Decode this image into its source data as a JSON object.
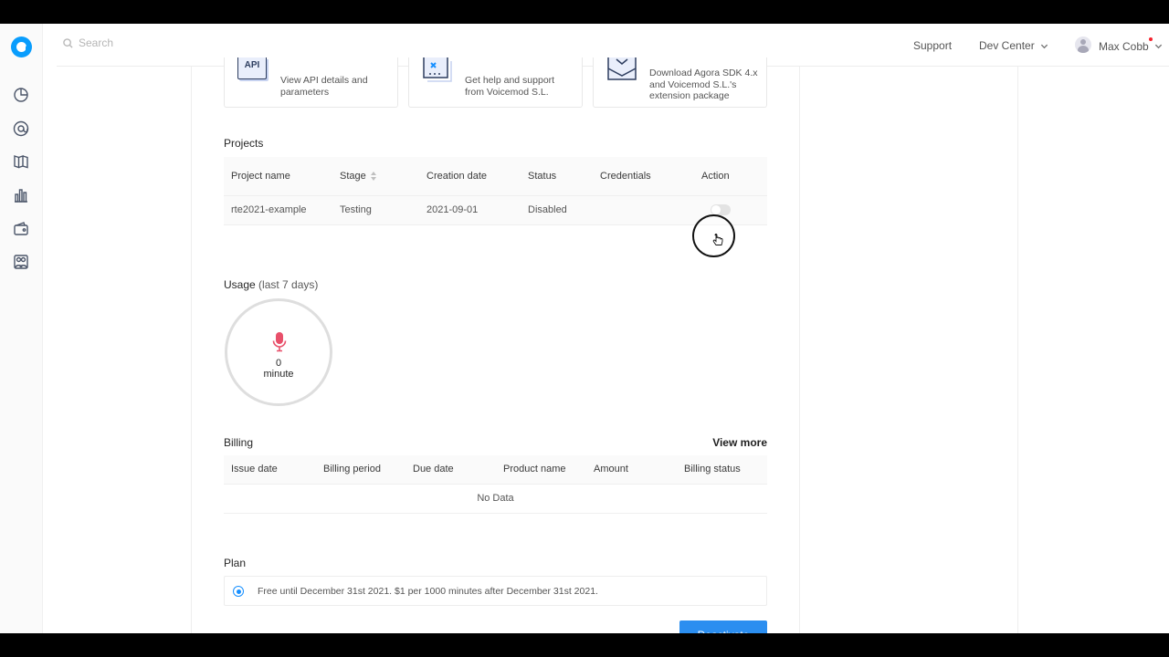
{
  "header": {
    "search_placeholder": "Search",
    "support_label": "Support",
    "dev_center_label": "Dev Center",
    "user_name": "Max Cobb"
  },
  "cards": [
    {
      "text_line1": "View API details and",
      "text_line2": "parameters",
      "icon_label": "API"
    },
    {
      "text_line1": "Get help and support",
      "text_line2": "from Voicemod S.L."
    },
    {
      "text_line1": "Download Agora SDK 4.x",
      "text_line2": "and Voicemod S.L.'s",
      "text_line3": "extension package"
    }
  ],
  "projects": {
    "title": "Projects",
    "columns": [
      "Project name",
      "Stage",
      "Creation date",
      "Status",
      "Credentials",
      "Action"
    ],
    "rows": [
      {
        "project_name": "rte2021-example",
        "stage": "Testing",
        "creation_date": "2021-09-01",
        "status": "Disabled",
        "credentials": "",
        "action_enabled": false
      }
    ]
  },
  "usage": {
    "title": "Usage",
    "period": "(last 7 days)",
    "value": "0",
    "unit": "minute",
    "icon": "microphone-icon",
    "icon_color": "#e8506a"
  },
  "billing": {
    "title": "Billing",
    "view_more_label": "View more",
    "columns": [
      "Issue date",
      "Billing period",
      "Due date",
      "Product name",
      "Amount",
      "Billing status"
    ],
    "empty_text": "No Data"
  },
  "plan": {
    "title": "Plan",
    "option_text": "Free until December 31st 2021. $1 per 1000 minutes after December 31st 2021.",
    "selected": true
  },
  "actions": {
    "deactivate_label": "Deactivate"
  },
  "colors": {
    "accent": "#2b8ef0",
    "brand": "#099dfd",
    "radio": "#1890ff"
  }
}
